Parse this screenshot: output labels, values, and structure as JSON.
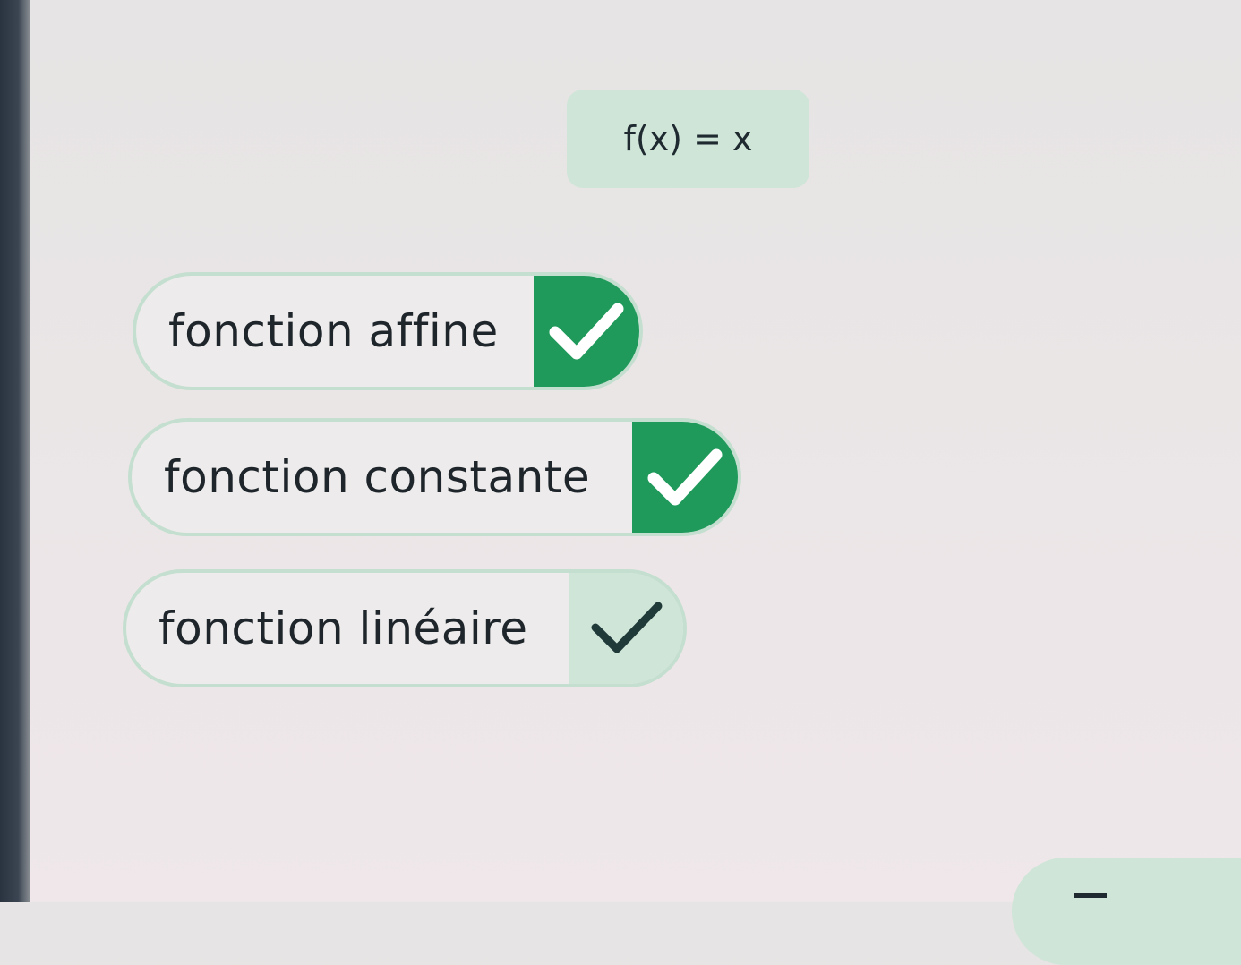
{
  "prompt": {
    "text": "f(x) = x"
  },
  "options": [
    {
      "label": "fonction affine",
      "selected": true
    },
    {
      "label": "fonction constante",
      "selected": true
    },
    {
      "label": "fonction linéaire",
      "selected": false
    }
  ],
  "colors": {
    "accent_green": "#1f9a5b",
    "light_green": "#cfe5d8",
    "border_green": "#c4dfcf",
    "text_dark": "#1f262b"
  },
  "icons": {
    "check": "checkmark-icon"
  }
}
